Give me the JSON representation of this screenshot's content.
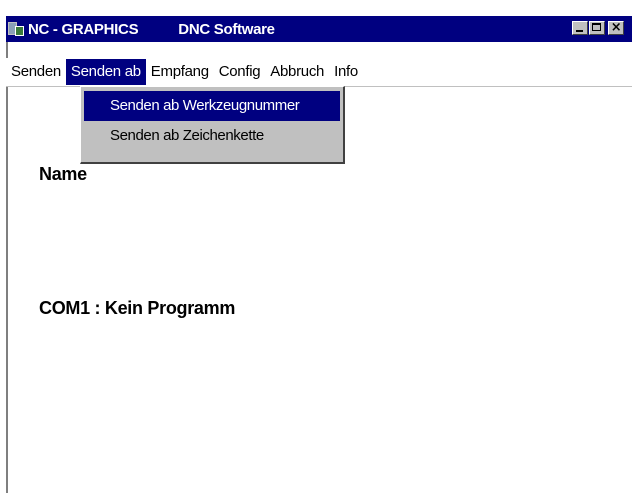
{
  "window": {
    "title": "NC - GRAPHICS",
    "subtitle": "DNC Software",
    "icon": "pc-network-icon",
    "buttons": {
      "minimize": "minimize-icon",
      "maximize": "maximize-icon",
      "close": "×"
    }
  },
  "menubar": {
    "items": [
      {
        "label": "Senden"
      },
      {
        "label": "Senden ab",
        "active": true
      },
      {
        "label": "Empfang"
      },
      {
        "label": "Config"
      },
      {
        "label": "Abbruch"
      },
      {
        "label": "Info"
      }
    ]
  },
  "dropdown": {
    "items": [
      {
        "label": "Senden ab Werkzeugnummer",
        "highlighted": true
      },
      {
        "label": "Senden ab Zeichenkette"
      }
    ]
  },
  "main": {
    "name_label": "Name",
    "status": "COM1 : Kein Programm"
  },
  "colors": {
    "titlebar": "#000080",
    "menu_highlight": "#000080",
    "menu_background": "#c0c0c0"
  }
}
